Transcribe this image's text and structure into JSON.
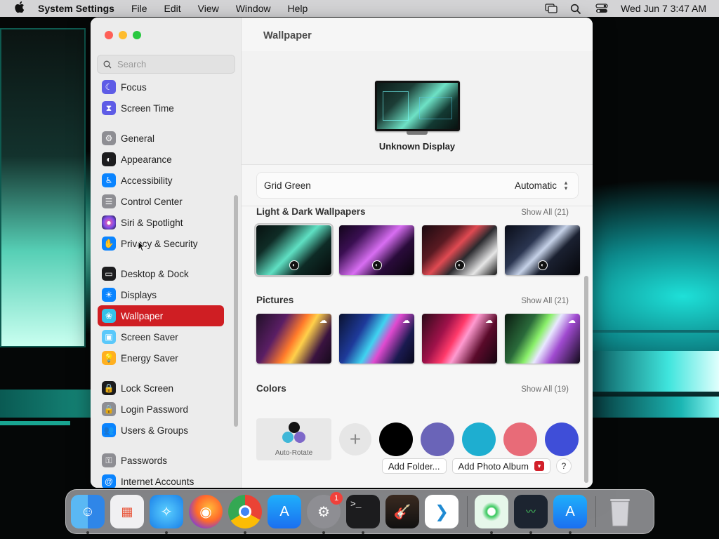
{
  "menubar": {
    "app_name": "System Settings",
    "menus": [
      "File",
      "Edit",
      "View",
      "Window",
      "Help"
    ],
    "clock": "Wed Jun 7  3:47 AM"
  },
  "sidebar": {
    "search_placeholder": "Search",
    "items": [
      {
        "label": "Focus",
        "icon": "moon-icon",
        "color": "#5e5ce6"
      },
      {
        "label": "Screen Time",
        "icon": "hourglass-icon",
        "color": "#5e5ce6"
      },
      {
        "label": "General",
        "icon": "gear-icon",
        "color": "#8e8e93"
      },
      {
        "label": "Appearance",
        "icon": "appearance-icon",
        "color": "#1c1c1e"
      },
      {
        "label": "Accessibility",
        "icon": "accessibility-icon",
        "color": "#0a84ff"
      },
      {
        "label": "Control Center",
        "icon": "control-center-icon",
        "color": "#8e8e93"
      },
      {
        "label": "Siri & Spotlight",
        "icon": "siri-icon",
        "color": "#7d4ce8"
      },
      {
        "label": "Privacy & Security",
        "icon": "hand-icon",
        "color": "#0a84ff"
      },
      {
        "label": "Desktop & Dock",
        "icon": "dock-icon",
        "color": "#1c1c1e"
      },
      {
        "label": "Displays",
        "icon": "sun-icon",
        "color": "#0a84ff"
      },
      {
        "label": "Wallpaper",
        "icon": "wallpaper-icon",
        "color": "#35c2e8"
      },
      {
        "label": "Screen Saver",
        "icon": "screen-saver-icon",
        "color": "#5ac8fa"
      },
      {
        "label": "Energy Saver",
        "icon": "bulb-icon",
        "color": "#ffb020"
      },
      {
        "label": "Lock Screen",
        "icon": "lock-icon",
        "color": "#1c1c1e"
      },
      {
        "label": "Login Password",
        "icon": "lock-gray-icon",
        "color": "#8e8e93"
      },
      {
        "label": "Users & Groups",
        "icon": "users-icon",
        "color": "#0a84ff"
      },
      {
        "label": "Passwords",
        "icon": "key-icon",
        "color": "#8e8e93"
      },
      {
        "label": "Internet Accounts",
        "icon": "at-icon",
        "color": "#0a84ff"
      }
    ],
    "active": "Wallpaper"
  },
  "main": {
    "title": "Wallpaper",
    "display_name": "Unknown Display",
    "current_wallpaper": "Grid Green",
    "mode": "Automatic",
    "sections": {
      "light_dark": {
        "label": "Light & Dark Wallpapers",
        "show_all": "Show All (21)"
      },
      "pictures": {
        "label": "Pictures",
        "show_all": "Show All (21)"
      },
      "colors": {
        "label": "Colors",
        "show_all": "Show All (19)"
      }
    },
    "auto_rotate_label": "Auto-Rotate",
    "color_swatches": [
      "#000000",
      "#6a64b8",
      "#1eaed0",
      "#e86b78",
      "#3f4ed8"
    ],
    "add_folder": "Add Folder...",
    "add_photo_album": "Add Photo Album",
    "help": "?"
  },
  "dock": {
    "apps": [
      "Finder",
      "Launchpad",
      "Safari",
      "Firefox",
      "Chrome",
      "App Store",
      "System Settings",
      "Terminal",
      "GarageBand",
      "VS Code",
      "Find My",
      "Activity Monitor",
      "App Store",
      "Trash"
    ],
    "settings_badge": "1"
  }
}
